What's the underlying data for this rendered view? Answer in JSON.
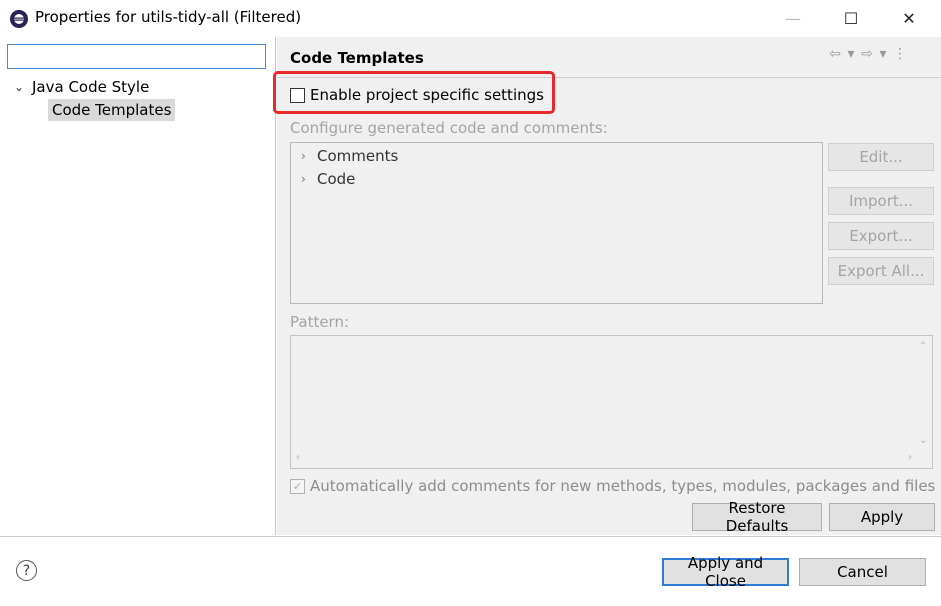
{
  "window": {
    "title": "Properties for utils-tidy-all (Filtered)",
    "min_symbol": "—",
    "max_symbol": "☐",
    "close_symbol": "✕"
  },
  "left": {
    "filter_value": "",
    "tree": {
      "parent_label": "Java Code Style",
      "child_label": "Code Templates"
    }
  },
  "page": {
    "title": "Code Templates",
    "enable_label": "Enable project specific settings",
    "configure_label": "Configure generated code and comments:",
    "template_items": [
      "Comments",
      "Code"
    ],
    "buttons": {
      "edit": "Edit...",
      "import": "Import...",
      "export": "Export...",
      "export_all": "Export All..."
    },
    "pattern_label": "Pattern:",
    "auto_comments_label": "Automatically add comments for new methods, types, modules, packages and files",
    "restore_defaults": "Restore Defaults",
    "apply": "Apply"
  },
  "footer": {
    "apply_and_close": "Apply and Close",
    "cancel": "Cancel",
    "help_symbol": "?"
  },
  "colors": {
    "highlight": "#e8282b",
    "focus": "#2f7ad8"
  }
}
